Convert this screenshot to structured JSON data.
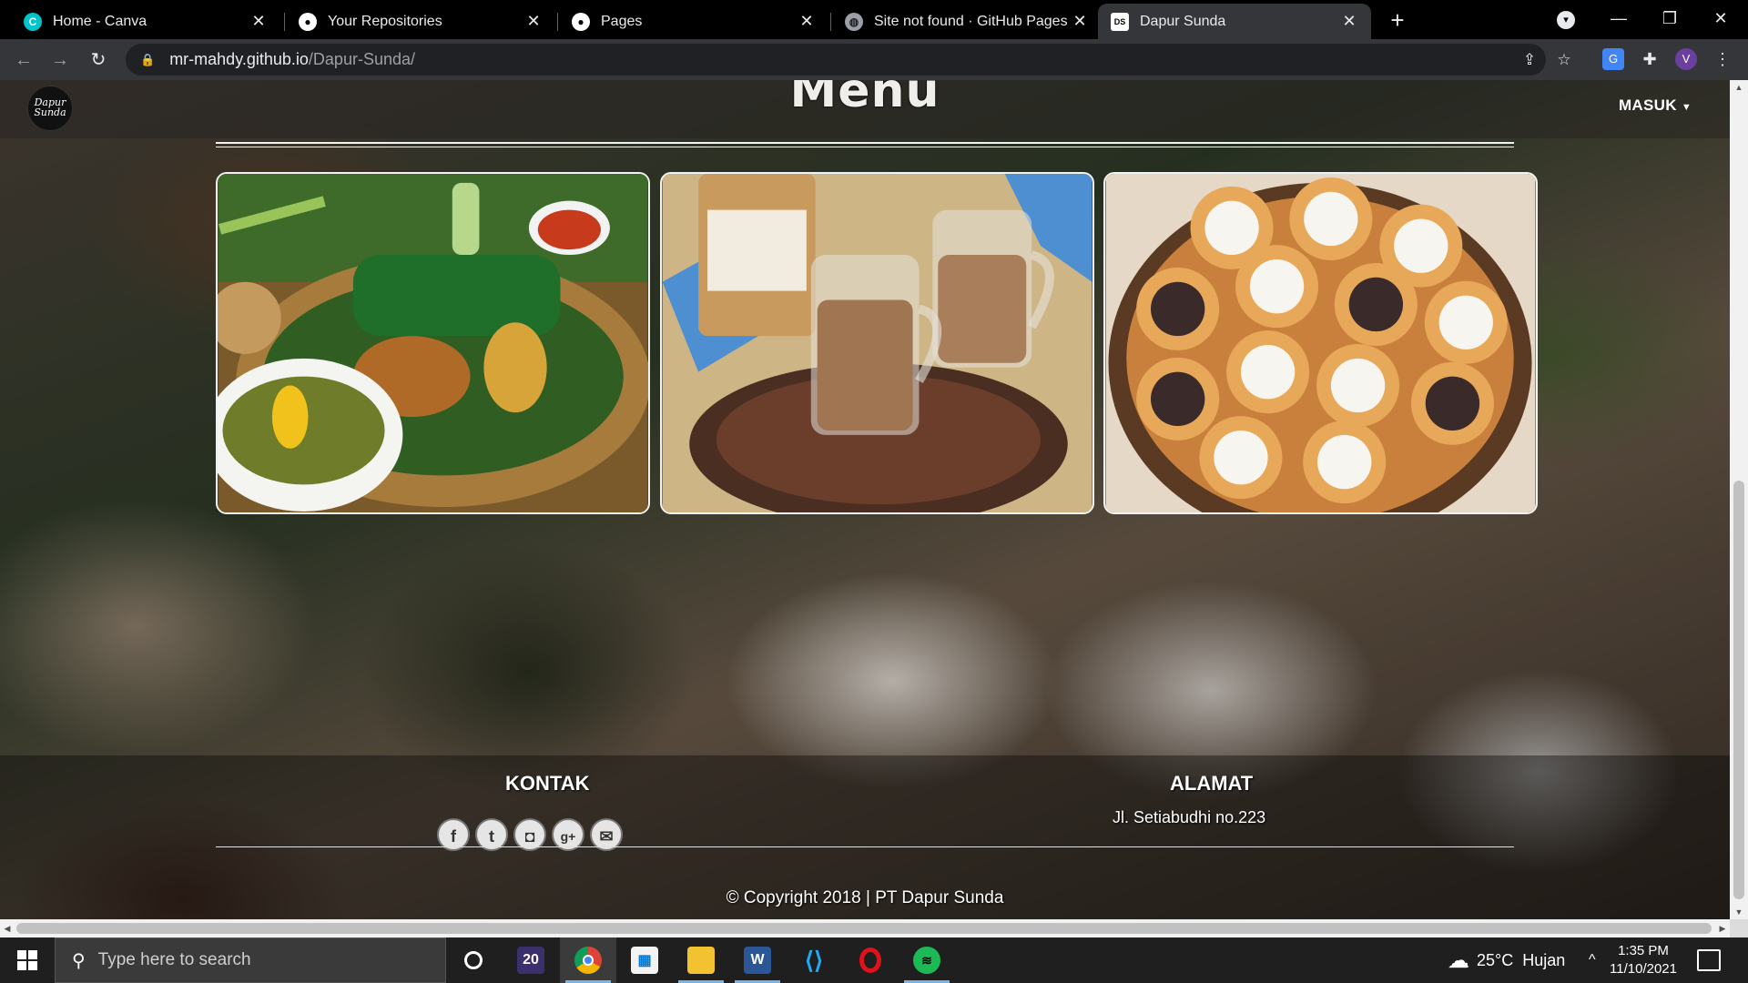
{
  "browser": {
    "tabs": [
      {
        "label": "Home - Canva",
        "icon": "canva-icon",
        "active": false
      },
      {
        "label": "Your Repositories",
        "icon": "github-icon",
        "active": false
      },
      {
        "label": "Pages",
        "icon": "github-icon",
        "active": false
      },
      {
        "label": "Site not found · GitHub Pages",
        "icon": "globe-icon",
        "active": false
      },
      {
        "label": "Dapur Sunda",
        "icon": "dapur-sunda-favicon",
        "active": true
      }
    ],
    "url_host": "mr-mahdy.github.io",
    "url_path": "/Dapur-Sunda/"
  },
  "site": {
    "logo_text": "Dapur Sunda",
    "masuk_label": "MASUK",
    "menu_title": "Menu",
    "menu_images": [
      {
        "alt": "Nasi timbel with fried chicken, tempe, tofu, sayur asem, sambal and lalapan"
      },
      {
        "alt": "Glasses of milk coffee on a rattan tray"
      },
      {
        "alt": "Serabi pancakes with assorted toppings"
      }
    ],
    "footer": {
      "kontak_heading": "KONTAK",
      "alamat_heading": "ALAMAT",
      "address": "Jl. Setiabudhi no.223",
      "social": [
        "facebook-icon",
        "twitter-icon",
        "instagram-icon",
        "google-plus-icon",
        "mail-icon"
      ],
      "copyright": "© Copyright 2018 | PT Dapur Sunda"
    }
  },
  "taskbar": {
    "search_placeholder": "Type here to search",
    "weather_temp": "25°C",
    "weather_text": "Hujan",
    "time": "1:35 PM",
    "date": "11/10/2021",
    "widget_badge": "20"
  }
}
